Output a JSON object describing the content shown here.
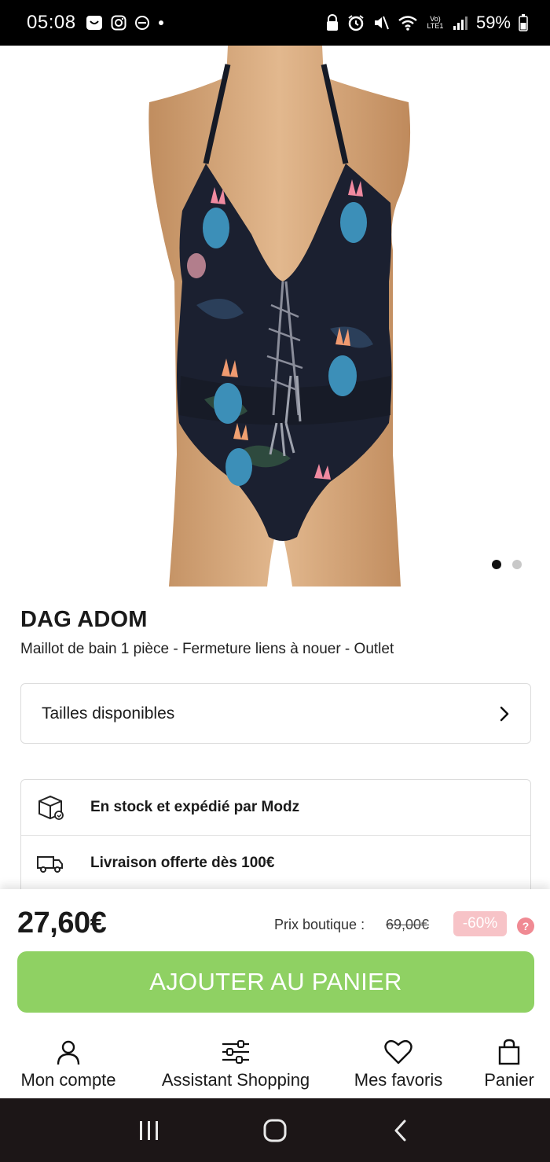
{
  "status_bar": {
    "time": "05:08",
    "battery": "59%",
    "left_icons": [
      "message-icon",
      "instagram-icon",
      "dnd-icon",
      "dot-icon"
    ],
    "right_icons": [
      "lock-icon",
      "alarm-icon",
      "mute-icon",
      "wifi-icon",
      "volte-icon",
      "signal-icon",
      "battery-icon"
    ],
    "volte_text": "Vo) LTE1"
  },
  "product": {
    "brand": "DAG ADOM",
    "subtitle": "Maillot de bain 1 pièce - Fermeture liens à nouer - Outlet",
    "image_icon": "swimsuit-product-image",
    "carousel": {
      "count": 2,
      "active": 1
    }
  },
  "sizes": {
    "label": "Tailles disponibles"
  },
  "info_rows": [
    {
      "icon": "package-icon",
      "text": "En stock et expédié par Modz"
    },
    {
      "icon": "truck-icon",
      "text": "Livraison offerte dès 100€"
    }
  ],
  "purchase": {
    "price": "27,60€",
    "ref_label": "Prix boutique :",
    "ref_price": "69,00€",
    "discount": "-60%",
    "help": "?",
    "add_to_cart": "AJOUTER AU PANIER"
  },
  "bottom_nav": [
    {
      "label": "Mon compte",
      "icon": "user-icon"
    },
    {
      "label": "Assistant Shopping",
      "icon": "sliders-icon"
    },
    {
      "label": "Mes favoris",
      "icon": "heart-icon"
    },
    {
      "label": "Panier",
      "icon": "bag-icon"
    }
  ],
  "colors": {
    "accent_green": "#8fd163",
    "discount_pink": "#f7c3c7",
    "help_pink": "#f08a93",
    "swimsuit_base": "#1b2030",
    "skin": "#d6a878"
  }
}
